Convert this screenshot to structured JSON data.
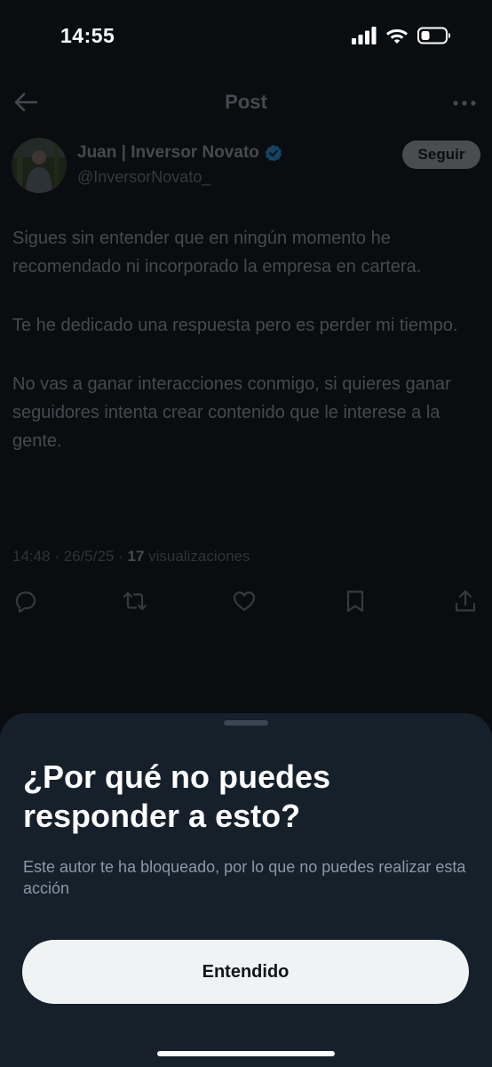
{
  "status_bar": {
    "time": "14:55",
    "icons": [
      "cellular-signal-icon",
      "wifi-icon",
      "battery-icon"
    ]
  },
  "header": {
    "title": "Post",
    "back_icon": "arrow-left-icon",
    "more_icon": "more-horizontal-icon"
  },
  "author": {
    "name": "Juan | Inversor Novato",
    "handle": "@InversorNovato_",
    "verified": true,
    "follow_label": "Seguir"
  },
  "post": {
    "paragraphs": [
      "Sigues sin entender que en ningún momento he recomendado ni incorporado la empresa en cartera.",
      "Te he dedicado una respuesta pero es perder mi tiempo.",
      "No vas a ganar interacciones conmigo, si quieres ganar seguidores intenta crear contenido que le interese a la gente."
    ],
    "time": "14:48",
    "date": "26/5/25",
    "separator": " · ",
    "views_count": "17",
    "views_label": "visualizaciones"
  },
  "actions": [
    "reply-icon",
    "repost-icon",
    "like-icon",
    "bookmark-icon",
    "share-icon"
  ],
  "sheet": {
    "title": "¿Por qué no puedes responder a esto?",
    "description": "Este autor te ha bloqueado, por lo que no puedes realizar esta acción",
    "button_label": "Entendido"
  },
  "colors": {
    "sheet_bg": "#15202b",
    "verified_blue": "#1d9bf0",
    "button_bg": "#eff3f4"
  }
}
